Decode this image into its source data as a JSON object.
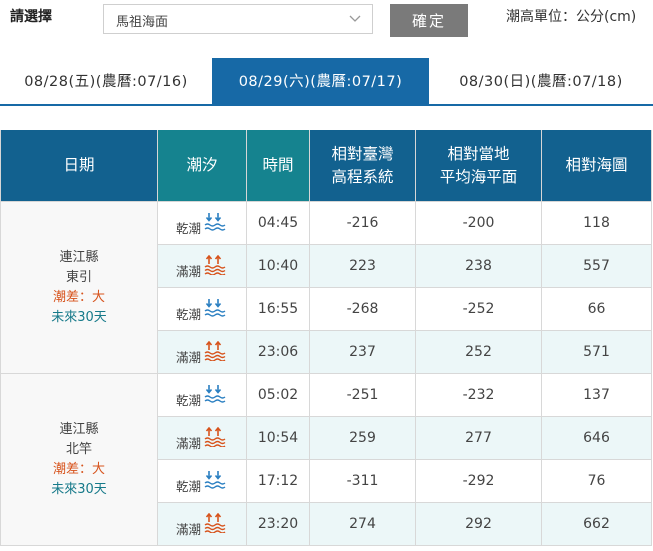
{
  "toolbar": {
    "select_label": "請選擇",
    "select_value": "馬祖海面",
    "confirm_label": "確定",
    "unit_label": "潮高單位：公分(cm)"
  },
  "tabs": [
    {
      "label": "08/28(五)(農曆:07/16)",
      "active": false
    },
    {
      "label": "08/29(六)(農曆:07/17)",
      "active": true
    },
    {
      "label": "08/30(日)(農曆:07/18)",
      "active": false
    }
  ],
  "table": {
    "headers": {
      "date": "日期",
      "tide": "潮汐",
      "time": "時間",
      "taiwan_line1": "相對臺灣",
      "taiwan_line2": "高程系統",
      "local_line1": "相對當地",
      "local_line2": "平均海平面",
      "chart": "相對海圖"
    },
    "groups": [
      {
        "county": "連江縣",
        "place": "東引",
        "range": "潮差：大",
        "forecast": "未來30天",
        "rows": [
          {
            "tide": "乾潮",
            "type": "low",
            "time": "04:45",
            "taiwan": "-216",
            "local": "-200",
            "chart": "118"
          },
          {
            "tide": "滿潮",
            "type": "high",
            "time": "10:40",
            "taiwan": "223",
            "local": "238",
            "chart": "557"
          },
          {
            "tide": "乾潮",
            "type": "low",
            "time": "16:55",
            "taiwan": "-268",
            "local": "-252",
            "chart": "66"
          },
          {
            "tide": "滿潮",
            "type": "high",
            "time": "23:06",
            "taiwan": "237",
            "local": "252",
            "chart": "571"
          }
        ]
      },
      {
        "county": "連江縣",
        "place": "北竿",
        "range": "潮差：大",
        "forecast": "未來30天",
        "rows": [
          {
            "tide": "乾潮",
            "type": "low",
            "time": "05:02",
            "taiwan": "-251",
            "local": "-232",
            "chart": "137"
          },
          {
            "tide": "滿潮",
            "type": "high",
            "time": "10:54",
            "taiwan": "259",
            "local": "277",
            "chart": "646"
          },
          {
            "tide": "乾潮",
            "type": "low",
            "time": "17:12",
            "taiwan": "-311",
            "local": "-292",
            "chart": "76"
          },
          {
            "tide": "滿潮",
            "type": "high",
            "time": "23:20",
            "taiwan": "274",
            "local": "292",
            "chart": "662"
          }
        ]
      }
    ]
  },
  "colors": {
    "header_blue": "#1a70b0",
    "header_teal": "#15838f",
    "active_tab": "#1769a6",
    "low_tide_icon": "#2a7fc1",
    "high_tide_icon": "#d7531c",
    "row_alt": "#ecf7f8"
  },
  "icons": {
    "low": "low-tide-icon",
    "high": "high-tide-icon"
  }
}
